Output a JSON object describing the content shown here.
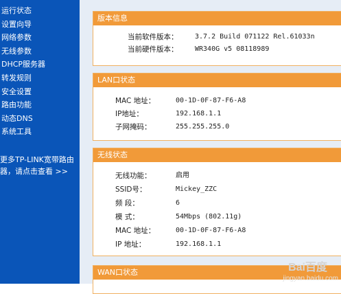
{
  "sidebar": {
    "items": [
      {
        "label": "运行状态"
      },
      {
        "label": "设置向导"
      },
      {
        "label": "网络参数"
      },
      {
        "label": "无线参数"
      },
      {
        "label": "DHCP服务器"
      },
      {
        "label": "转发规则"
      },
      {
        "label": "安全设置"
      },
      {
        "label": "路由功能"
      },
      {
        "label": "动态DNS"
      },
      {
        "label": "系统工具"
      }
    ],
    "promo_line1": "更多TP-LINK宽带路由",
    "promo_line2": "器，请点击查看 >>"
  },
  "panels": {
    "version": {
      "title": "版本信息",
      "rows": [
        {
          "label": "当前软件版本：",
          "value": "3.7.2 Build 071122 Rel.61033n"
        },
        {
          "label": "当前硬件版本：",
          "value": "WR340G v5 08118989"
        }
      ]
    },
    "lan": {
      "title": "LAN口状态",
      "rows": [
        {
          "label": "MAC 地址：",
          "value": "00-1D-0F-87-F6-A8"
        },
        {
          "label": "IP地址：",
          "value": "192.168.1.1"
        },
        {
          "label": "子网掩码：",
          "value": "255.255.255.0"
        }
      ]
    },
    "wireless": {
      "title": "无线状态",
      "rows": [
        {
          "label": "无线功能：",
          "value": "启用"
        },
        {
          "label": "SSID号：",
          "value": "Mickey_ZZC"
        },
        {
          "label": "频 段：",
          "value": "6"
        },
        {
          "label": "模 式：",
          "value": "54Mbps (802.11g)"
        },
        {
          "label": "MAC 地址：",
          "value": "00-1D-0F-87-F6-A8"
        },
        {
          "label": "IP 地址：",
          "value": "192.168.1.1"
        }
      ]
    },
    "wan": {
      "title": "WAN口状态"
    }
  },
  "watermark": {
    "logo": "Bai百度",
    "text": "jingyan.baidu.com"
  }
}
